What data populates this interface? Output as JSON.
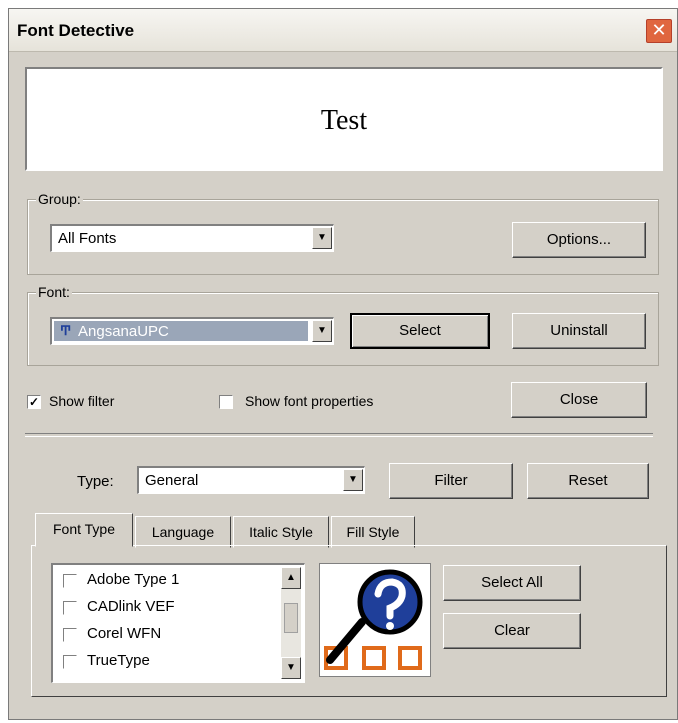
{
  "window": {
    "title": "Font Detective"
  },
  "preview": {
    "text": "Test"
  },
  "group_section": {
    "legend": "Group:",
    "selected": "All Fonts",
    "options_button": "Options..."
  },
  "font_section": {
    "legend": "Font:",
    "selected": "AngsanaUPC",
    "select_button": "Select",
    "uninstall_button": "Uninstall"
  },
  "show_filter": {
    "label": "Show filter",
    "checked": true
  },
  "show_font_properties": {
    "label": "Show font properties",
    "checked": false
  },
  "close_button": "Close",
  "filter_row": {
    "type_label": "Type:",
    "type_selected": "General",
    "filter_button": "Filter",
    "reset_button": "Reset"
  },
  "tabs": [
    {
      "label": "Font Type",
      "active": true
    },
    {
      "label": "Language",
      "active": false
    },
    {
      "label": "Italic Style",
      "active": false
    },
    {
      "label": "Fill Style",
      "active": false
    }
  ],
  "font_types": [
    {
      "label": "Adobe Type 1",
      "checked": false
    },
    {
      "label": "CADlink VEF",
      "checked": false
    },
    {
      "label": "Corel WFN",
      "checked": false
    },
    {
      "label": "TrueType",
      "checked": false
    }
  ],
  "select_all_button": "Select All",
  "clear_button": "Clear",
  "icons": {
    "close": "close-icon",
    "magnifier": "magnifier-icon",
    "font": "truetype-font-icon"
  },
  "colors": {
    "selection": "#9aa6b8",
    "close_button": "#e0663f",
    "accent_orange": "#e06a1a",
    "accent_blue": "#1f3f9a"
  }
}
